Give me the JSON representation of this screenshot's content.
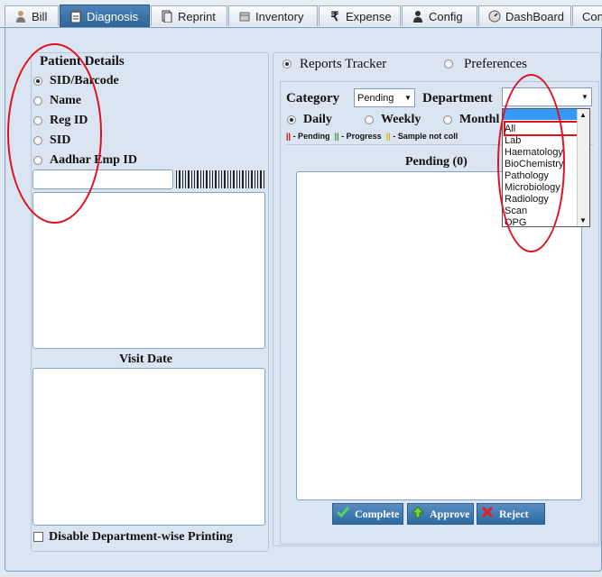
{
  "tabs": [
    {
      "label": "Bill",
      "icon": "user-icon",
      "active": false
    },
    {
      "label": "Diagnosis",
      "icon": "clipboard-icon",
      "active": true
    },
    {
      "label": "Reprint",
      "icon": "reprint-icon",
      "active": false
    },
    {
      "label": "Inventory",
      "icon": "inventory-icon",
      "active": false
    },
    {
      "label": "Expense",
      "icon": "rupee-icon",
      "active": false
    },
    {
      "label": "Config",
      "icon": "person-config-icon",
      "active": false
    },
    {
      "label": "DashBoard",
      "icon": "dashboard-icon",
      "active": false
    },
    {
      "label": "Con",
      "icon": "",
      "active": false
    }
  ],
  "patient": {
    "title": "Patient Details",
    "options": [
      "SID/Barcode",
      "Name",
      "Reg ID",
      "SID",
      "Aadhar Emp ID"
    ],
    "selected": "SID/Barcode",
    "search_value": "",
    "visit_date_label": "Visit Date",
    "disable_printing_label": "Disable Department-wise Printing"
  },
  "right": {
    "mode_options": [
      "Reports Tracker",
      "Preferences"
    ],
    "mode_selected": "Reports Tracker",
    "category_label": "Category",
    "category_value": "Pending",
    "department_label": "Department",
    "department_value": "",
    "period_options": [
      "Daily",
      "Weekly",
      "Monthl"
    ],
    "period_selected": "Daily",
    "legend": {
      "pending": "- Pending",
      "progress": "- Progress",
      "notcollected": "- Sample not coll"
    },
    "pending_header": "Pending (0)",
    "buttons": {
      "complete": "Complete",
      "approve": "Approve",
      "reject": "Reject"
    }
  },
  "department_dropdown": [
    "All",
    "Lab",
    "Haematology",
    "BioChemistry",
    "Pathology",
    "Microbiology",
    "Radiology",
    "Scan",
    "OPG"
  ],
  "colors": {
    "tab_active": "#3a6fa3",
    "annotation": "#e01020",
    "button": "#2d6aa3",
    "legend_pending": "#c00000",
    "legend_progress": "#2e8b2e",
    "legend_notcollected": "#c8b400"
  }
}
